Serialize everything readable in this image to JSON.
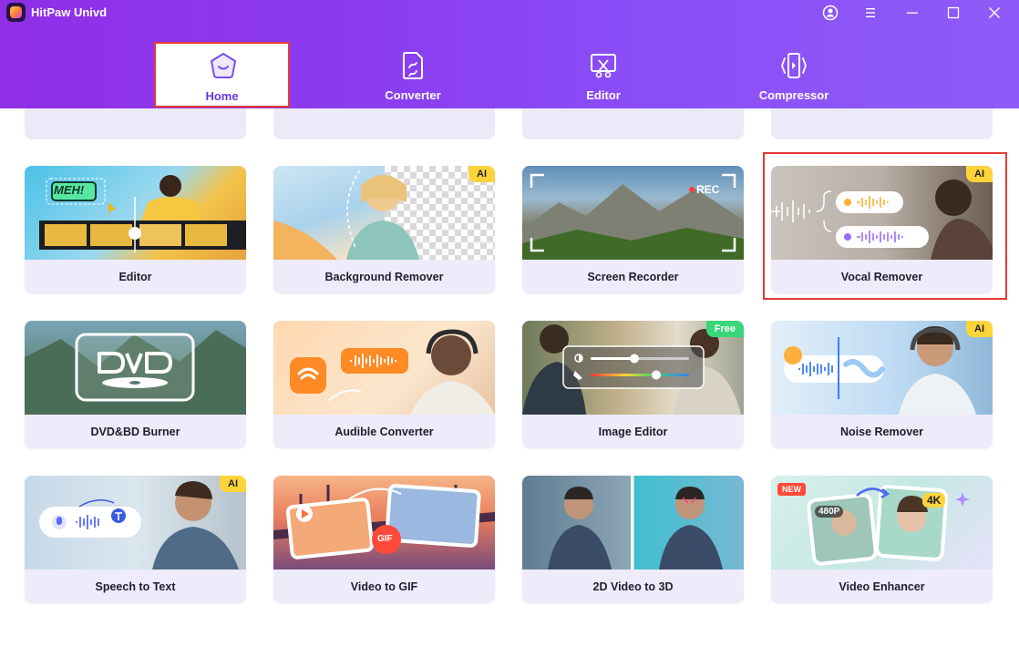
{
  "app": {
    "title": "HitPaw Univd"
  },
  "colors": {
    "accent": "#6a36e6",
    "header": "#8a3cf0",
    "highlight": "#e53935",
    "ai_badge": "#ffd43a",
    "free_badge": "#39d67a",
    "new_badge": "#ff4a3a"
  },
  "window_controls": [
    "account-icon",
    "menu-icon",
    "minimize-icon",
    "maximize-icon",
    "close-icon"
  ],
  "tabs": [
    {
      "label": "Home",
      "icon": "home-icon",
      "selected": true
    },
    {
      "label": "Converter",
      "icon": "converter-icon",
      "selected": false
    },
    {
      "label": "Editor",
      "icon": "editor-icon",
      "selected": false
    },
    {
      "label": "Compressor",
      "icon": "compressor-icon",
      "selected": false
    }
  ],
  "tools": [
    {
      "label": "Editor",
      "badge": ""
    },
    {
      "label": "Background Remover",
      "badge": "AI"
    },
    {
      "label": "Screen Recorder",
      "badge": "",
      "overlay_text": "REC"
    },
    {
      "label": "Vocal Remover",
      "badge": "AI",
      "highlighted": true
    },
    {
      "label": "DVD&BD Burner",
      "badge": ""
    },
    {
      "label": "Audible Converter",
      "badge": ""
    },
    {
      "label": "Image Editor",
      "badge": "Free"
    },
    {
      "label": "Noise Remover",
      "badge": "AI"
    },
    {
      "label": "Speech to Text",
      "badge": "AI"
    },
    {
      "label": "Video to GIF",
      "badge": "",
      "overlay_text": "GIF"
    },
    {
      "label": "2D Video to 3D",
      "badge": ""
    },
    {
      "label": "Video Enhancer",
      "badge": "NEW",
      "overlay_from": "480P",
      "overlay_to": "4K"
    }
  ],
  "editor_thumb_text": "MEH!"
}
